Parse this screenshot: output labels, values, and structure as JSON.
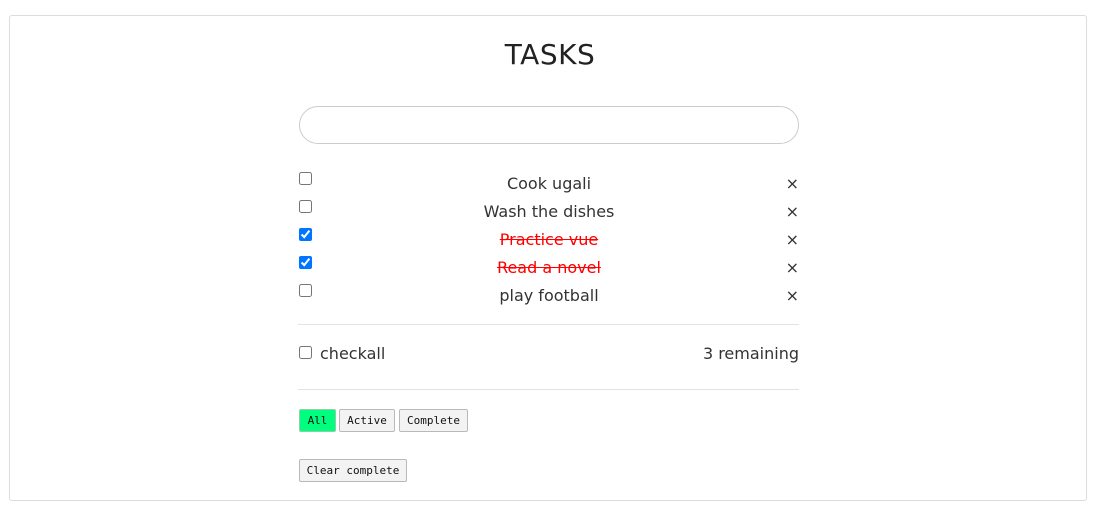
{
  "app": {
    "title": "TASKS"
  },
  "new_task": {
    "value": "",
    "placeholder": ""
  },
  "tasks": [
    {
      "label": "Cook ugali",
      "completed": false
    },
    {
      "label": "Wash the dishes",
      "completed": false
    },
    {
      "label": "Practice vue",
      "completed": true
    },
    {
      "label": "Read a novel",
      "completed": true
    },
    {
      "label": "play football",
      "completed": false
    }
  ],
  "remove_glyph": "×",
  "footer": {
    "checkall_label": "checkall",
    "remaining_text": "3 remaining"
  },
  "filters": [
    {
      "label": "All",
      "active": true
    },
    {
      "label": "Active",
      "active": false
    },
    {
      "label": "Complete",
      "active": false
    }
  ],
  "clear_label": "Clear complete",
  "colors": {
    "completed_text": "#ff0000",
    "active_filter": "#00ff7f"
  }
}
